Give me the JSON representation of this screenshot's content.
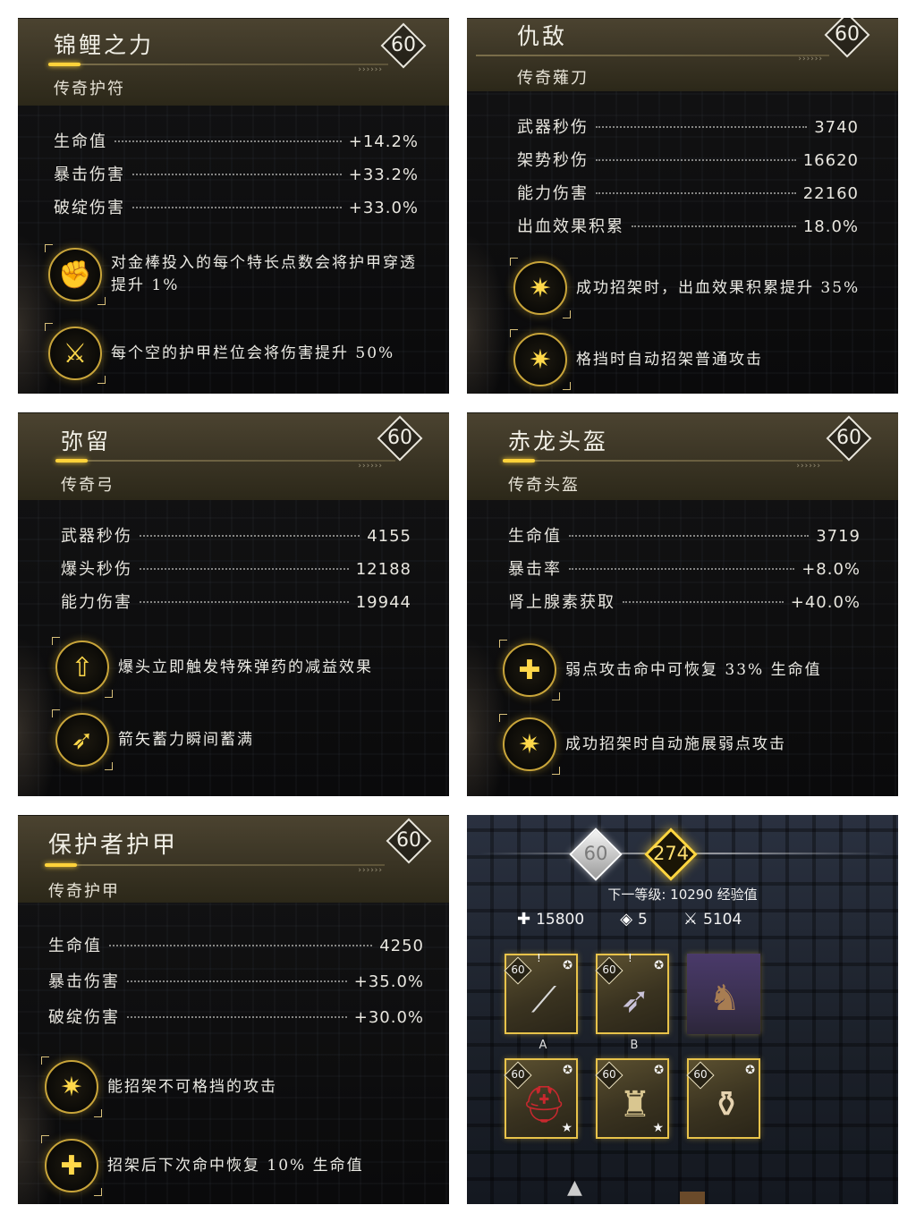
{
  "cards": [
    {
      "title": "锦鲤之力",
      "subtitle": "传奇护符",
      "level": "60",
      "stats": [
        {
          "label": "生命值",
          "value": "+14.2%"
        },
        {
          "label": "暴击伤害",
          "value": "+33.2%"
        },
        {
          "label": "破绽伤害",
          "value": "+33.0%"
        }
      ],
      "perks": [
        {
          "icon": "gold-fist-icon",
          "text": "对金棒投入的每个特长点数会将护甲穿透提升 1%"
        },
        {
          "icon": "crossed-swords-icon",
          "text": "每个空的护甲栏位会将伤害提升 50%"
        }
      ]
    },
    {
      "title": "仇敌",
      "subtitle": "传奇薙刀",
      "level": "60",
      "stats": [
        {
          "label": "武器秒伤",
          "value": "3740"
        },
        {
          "label": "架势秒伤",
          "value": "16620"
        },
        {
          "label": "能力伤害",
          "value": "22160"
        },
        {
          "label": "出血效果积累",
          "value": "18.0%"
        }
      ],
      "perks": [
        {
          "icon": "parry-burst-icon",
          "text": "成功招架时，出血效果积累提升 35%"
        },
        {
          "icon": "parry-burst-icon",
          "text": "格挡时自动招架普通攻击"
        }
      ]
    },
    {
      "title": "弥留",
      "subtitle": "传奇弓",
      "level": "60",
      "stats": [
        {
          "label": "武器秒伤",
          "value": "4155"
        },
        {
          "label": "爆头秒伤",
          "value": "12188"
        },
        {
          "label": "能力伤害",
          "value": "19944"
        }
      ],
      "perks": [
        {
          "icon": "ammo-upgrade-icon",
          "text": "爆头立即触发特殊弹药的减益效果"
        },
        {
          "icon": "bow-arrows-icon",
          "text": "箭矢蓄力瞬间蓄满"
        }
      ]
    },
    {
      "title": "赤龙头盔",
      "subtitle": "传奇头盔",
      "level": "60",
      "stats": [
        {
          "label": "生命值",
          "value": "3719"
        },
        {
          "label": "暴击率",
          "value": "+8.0%"
        },
        {
          "label": "肾上腺素获取",
          "value": "+40.0%"
        }
      ],
      "perks": [
        {
          "icon": "heal-plus-icon",
          "text": "弱点攻击命中可恢复 33% 生命值"
        },
        {
          "icon": "parry-burst-icon",
          "text": "成功招架时自动施展弱点攻击"
        }
      ]
    },
    {
      "title": "保护者护甲",
      "subtitle": "传奇护甲",
      "level": "60",
      "stats": [
        {
          "label": "生命值",
          "value": "4250"
        },
        {
          "label": "暴击伤害",
          "value": "+35.0%"
        },
        {
          "label": "破绽伤害",
          "value": "+30.0%"
        }
      ],
      "perks": [
        {
          "icon": "parry-burst-icon",
          "text": "能招架不可格挡的攻击"
        },
        {
          "icon": "heal-plus-icon",
          "text": "招架后下次命中恢复 10% 生命值"
        }
      ]
    }
  ],
  "character": {
    "level": "60",
    "gear_score": "274",
    "next_level": "下一等级: 10290 经验值",
    "stats": [
      {
        "icon": "health-cross-icon",
        "value": "15800"
      },
      {
        "icon": "diamond-icon",
        "value": "5"
      },
      {
        "icon": "crossed-swords-icon",
        "value": "5104"
      }
    ],
    "gear_slots": [
      {
        "name": "weapon-a",
        "level": "60",
        "slot_label": "A"
      },
      {
        "name": "weapon-b",
        "level": "60",
        "slot_label": "B"
      },
      {
        "name": "horse",
        "level": "",
        "slot_label": ""
      },
      {
        "name": "helmet",
        "level": "60",
        "slot_label": ""
      },
      {
        "name": "armor",
        "level": "60",
        "slot_label": ""
      },
      {
        "name": "charm",
        "level": "60",
        "slot_label": ""
      }
    ]
  },
  "colors": {
    "accent": "#ffd23a",
    "header": "#3a3424",
    "panel": "#0c0c0d"
  }
}
